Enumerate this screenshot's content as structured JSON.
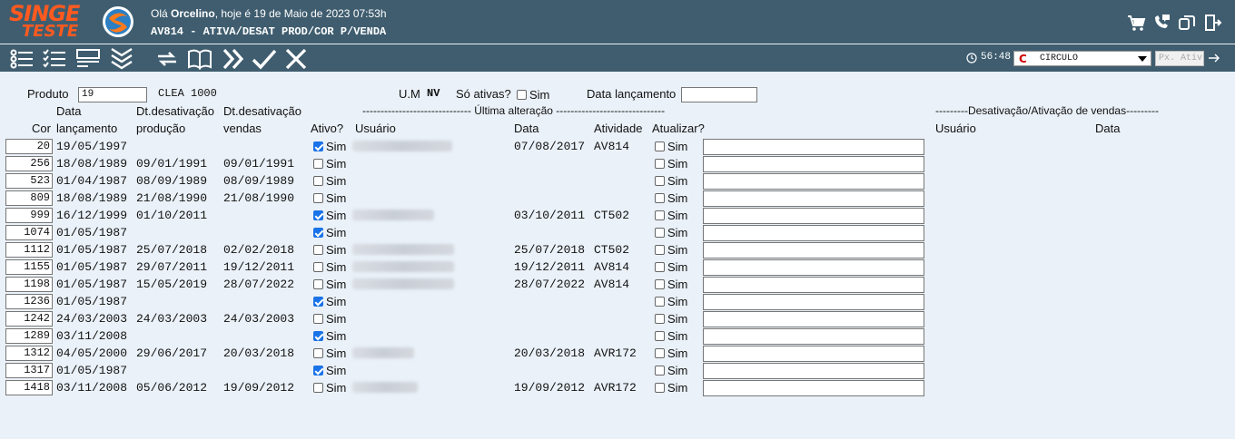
{
  "header": {
    "logo_brand": "SINGE",
    "logo_env": "TESTE",
    "greeting_prefix": "Olá ",
    "user_name": "Orcelino",
    "greeting_suffix": ", hoje é 19 de Maio de 2023 07:53h",
    "screen_title": "AV814 - ATIVA/DESAT PROD/COR P/VENDA",
    "icons": [
      "cart-icon",
      "support-chat-icon",
      "windows-icon",
      "logout-icon"
    ]
  },
  "toolbar": {
    "buttons": [
      "list-icon",
      "checklist-icon",
      "form-icon",
      "collapse-all-icon",
      "refresh-icon",
      "book-icon",
      "forward-icon",
      "confirm-icon",
      "cancel-icon"
    ],
    "session_time": "56:48",
    "company_logo": "C",
    "company": "CIRCULO",
    "next_activity_placeholder": "Px. Ativ"
  },
  "filters": {
    "produto_label": "Produto",
    "produto_value": "19",
    "produto_desc": "CLEA 1000",
    "um_label": "U.M",
    "um_value": "NV",
    "so_ativas_label": "Só ativas?",
    "sim_label": "Sim",
    "so_ativas_checked": false,
    "data_lancamento_label": "Data lançamento",
    "data_lancamento_value": ""
  },
  "columns": {
    "cor": "Cor",
    "data_top": "Data",
    "data_bottom": "lançamento",
    "dtdesat_top": "Dt.desativação",
    "dtdesat_prod": "produção",
    "dtdesat_vendas": "vendas",
    "ativo": "Ativo?",
    "ultima_alteracao": "------------------------------ Última alteração ------------------------------",
    "usuario": "Usuário",
    "data": "Data",
    "atividade": "Atividade",
    "atualizar": "Atualizar?",
    "desat_vendas": "---------Desativação/Ativação de vendas---------",
    "desat_usuario": "Usuário",
    "desat_data": "Data"
  },
  "rows": [
    {
      "cor": "20",
      "lanc": "19/05/1997",
      "prod": "",
      "vendas": "",
      "ativo": true,
      "usuario_hidden": true,
      "alt_data": "07/08/2017",
      "atividade": "AV814"
    },
    {
      "cor": "256",
      "lanc": "18/08/1989",
      "prod": "09/01/1991",
      "vendas": "09/01/1991",
      "ativo": false,
      "usuario_hidden": false,
      "alt_data": "",
      "atividade": ""
    },
    {
      "cor": "523",
      "lanc": "01/04/1987",
      "prod": "08/09/1989",
      "vendas": "08/09/1989",
      "ativo": false,
      "usuario_hidden": false,
      "alt_data": "",
      "atividade": ""
    },
    {
      "cor": "809",
      "lanc": "18/08/1989",
      "prod": "21/08/1990",
      "vendas": "21/08/1990",
      "ativo": false,
      "usuario_hidden": false,
      "alt_data": "",
      "atividade": ""
    },
    {
      "cor": "999",
      "lanc": "16/12/1999",
      "prod": "01/10/2011",
      "vendas": "",
      "ativo": true,
      "usuario_hidden": true,
      "alt_data": "03/10/2011",
      "atividade": "CT502"
    },
    {
      "cor": "1074",
      "lanc": "01/05/1987",
      "prod": "",
      "vendas": "",
      "ativo": true,
      "usuario_hidden": false,
      "alt_data": "",
      "atividade": ""
    },
    {
      "cor": "1112",
      "lanc": "01/05/1987",
      "prod": "25/07/2018",
      "vendas": "02/02/2018",
      "ativo": false,
      "usuario_hidden": true,
      "alt_data": "25/07/2018",
      "atividade": "CT502"
    },
    {
      "cor": "1155",
      "lanc": "01/05/1987",
      "prod": "29/07/2011",
      "vendas": "19/12/2011",
      "ativo": false,
      "usuario_hidden": true,
      "alt_data": "19/12/2011",
      "atividade": "AV814"
    },
    {
      "cor": "1198",
      "lanc": "01/05/1987",
      "prod": "15/05/2019",
      "vendas": "28/07/2022",
      "ativo": false,
      "usuario_hidden": true,
      "alt_data": "28/07/2022",
      "atividade": "AV814"
    },
    {
      "cor": "1236",
      "lanc": "01/05/1987",
      "prod": "",
      "vendas": "",
      "ativo": true,
      "usuario_hidden": false,
      "alt_data": "",
      "atividade": ""
    },
    {
      "cor": "1242",
      "lanc": "24/03/2003",
      "prod": "24/03/2003",
      "vendas": "24/03/2003",
      "ativo": false,
      "usuario_hidden": false,
      "alt_data": "",
      "atividade": ""
    },
    {
      "cor": "1289",
      "lanc": "03/11/2008",
      "prod": "",
      "vendas": "",
      "ativo": true,
      "usuario_hidden": false,
      "alt_data": "",
      "atividade": ""
    },
    {
      "cor": "1312",
      "lanc": "04/05/2000",
      "prod": "29/06/2017",
      "vendas": "20/03/2018",
      "ativo": false,
      "usuario_hidden": true,
      "alt_data": "20/03/2018",
      "atividade": "AVR172"
    },
    {
      "cor": "1317",
      "lanc": "01/05/1987",
      "prod": "",
      "vendas": "",
      "ativo": true,
      "usuario_hidden": false,
      "alt_data": "",
      "atividade": ""
    },
    {
      "cor": "1418",
      "lanc": "03/11/2008",
      "prod": "05/06/2012",
      "vendas": "19/09/2012",
      "ativo": false,
      "usuario_hidden": true,
      "alt_data": "19/09/2012",
      "atividade": "AVR172"
    }
  ],
  "colors": {
    "header_bg": "#3f5d6f",
    "page_bg": "#eaf1f8",
    "brand": "#ff5a1f",
    "checkbox": "#1a73e8"
  }
}
